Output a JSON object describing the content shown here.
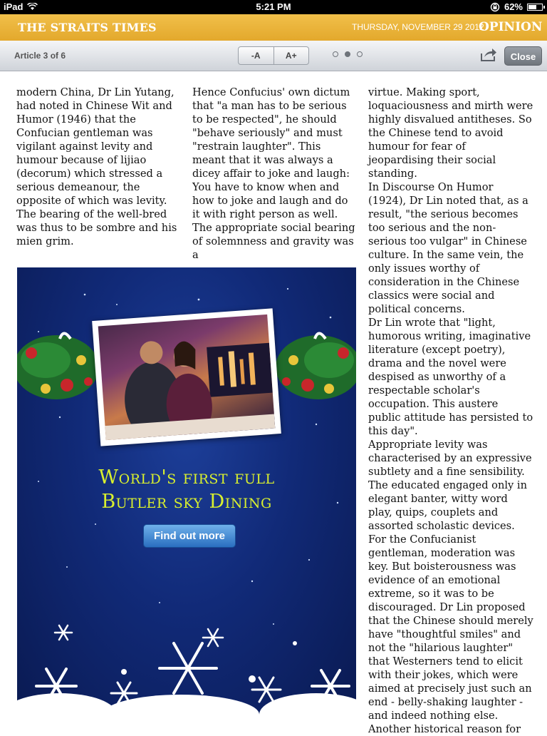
{
  "status_bar": {
    "device": "iPad",
    "time": "5:21 PM",
    "battery": "62%",
    "battery_level": 0.62
  },
  "masthead": {
    "brand": "THE STRAITS TIMES",
    "date": "THURSDAY, NOVEMBER 29 2012",
    "section": "OPINION"
  },
  "toolbar": {
    "article_counter": "Article 3 of 6",
    "font_decrease": "-A",
    "font_increase": "A+",
    "page_dots": [
      false,
      true,
      false
    ],
    "close_label": "Close"
  },
  "article": {
    "col1": [
      "modern China, Dr Lin Yutang, had noted in Chinese Wit and Humor (1946) that the Confucian gentleman was vigilant against levity and humour because of lijiao (decorum) which stressed a serious demeanour, the opposite of which was levity. The bearing of the well-bred was thus to be sombre and his mien grim."
    ],
    "col2": [
      " Hence Confucius' own dictum that \"a man has to be serious to be respected\", he should \"behave seriously\" and must \"restrain laughter\". This meant that it was always a dicey affair to joke and laugh: You have to know when and how to joke and laugh and do it with right person as well.",
      " The appropriate social bearing of solemnness and gravity was a"
    ],
    "col3": [
      "virtue. Making sport, loquaciousness and mirth were highly disvalued antitheses. So the Chinese tend to avoid humour for fear of jeopardising their social standing.",
      " In Discourse On Humor (1924), Dr Lin noted that, as a result, \"the serious becomes too serious and the non-serious too vulgar\" in Chinese culture. In the same vein, the only issues worthy of consideration in the Chinese classics were social and political concerns.",
      " Dr Lin wrote that \"light, humorous writing, imaginative literature (except poetry), drama and the novel were despised as unworthy of a respectable scholar's occupation. This austere public attitude has persisted to this day\".",
      " Appropriate levity was characterised by an expressive subtlety and a fine sensibility. The educated engaged only in elegant banter, witty word play, quips, couplets and assorted scholastic devices.",
      " For the Confucianist gentleman, moderation was key. But boisterousness was evidence of an emotional extreme, so it was to be discouraged. Dr Lin proposed that the Chinese should merely have \"thoughtful smiles\" and not the \"hilarious laughter\" that Westerners tend to elicit with their jokes, which were aimed at precisely just such an end - belly-shaking laughter - and indeed nothing else.",
      " Another historical reason for"
    ]
  },
  "ad": {
    "title_line1": "World's first full",
    "title_line2": "Butler sky Dining",
    "button": "Find out more",
    "title_color": "#d8ef2e",
    "background": "#112a78"
  }
}
